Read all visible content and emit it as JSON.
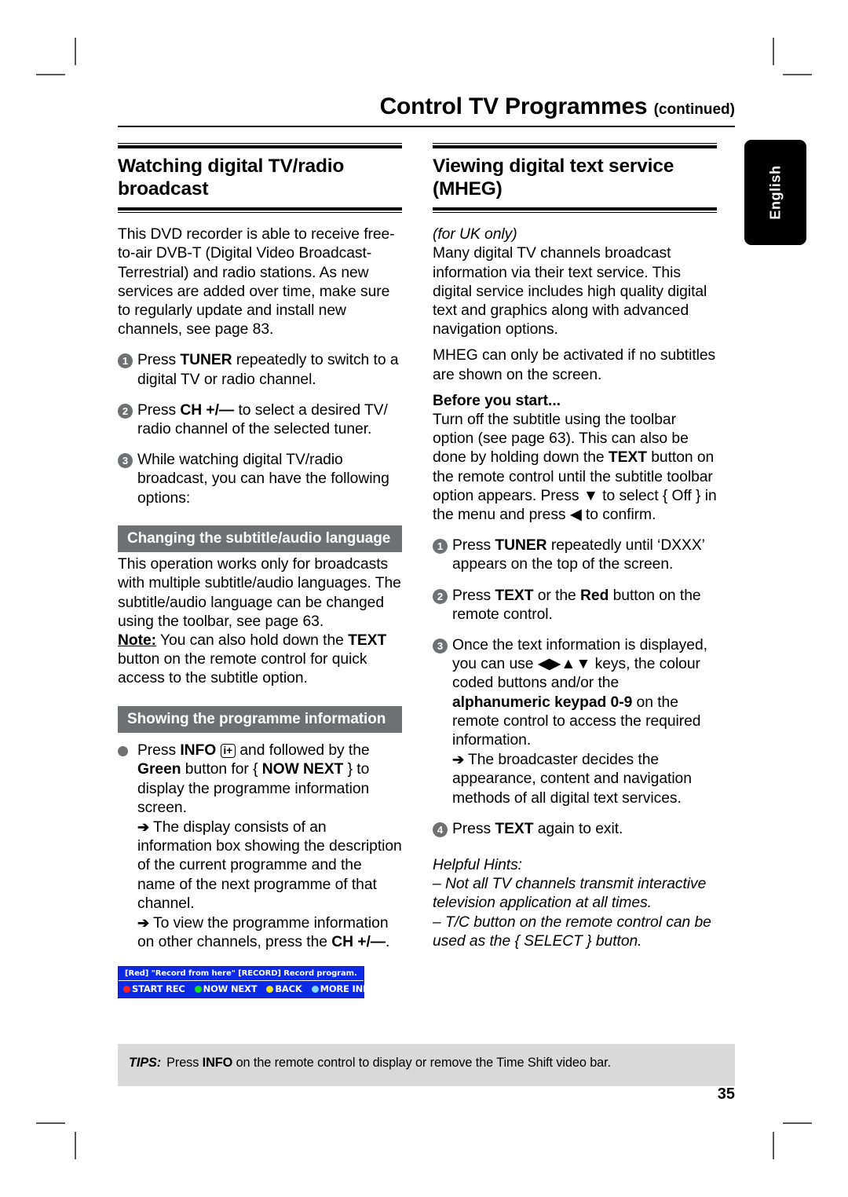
{
  "header": {
    "title": "Control TV Programmes",
    "continued": "(continued)"
  },
  "thumb_tab": {
    "label": "English"
  },
  "left_column": {
    "heading": "Watching digital TV/radio broadcast",
    "intro": "This DVD recorder is able to receive free-to-air DVB-T (Digital Video Broadcast-Terrestrial) and radio stations. As new services are added over time, make sure to regularly update and install new channels, see page 83.",
    "steps": [
      {
        "num": "1",
        "pre": "Press ",
        "bold": "TUNER",
        "post": " repeatedly to switch to a digital TV or radio channel."
      },
      {
        "num": "2",
        "pre": "Press ",
        "bold": "CH +/—",
        "post": " to select a desired TV/ radio channel of the selected tuner."
      },
      {
        "num": "3",
        "pre": "",
        "bold": "",
        "post": "While watching digital TV/radio broadcast, you can have the following options:"
      }
    ],
    "subsection_1": {
      "bar_title": "Changing the subtitle/audio language",
      "para_1": "This operation works only for broadcasts with multiple subtitle/audio languages. The subtitle/audio language can be changed using the toolbar, see page 63.",
      "note_label": "Note:",
      "note_pre": "  You can also hold down the ",
      "note_bold": "TEXT",
      "note_post": " button on the remote control for quick access to the subtitle option."
    },
    "subsection_2": {
      "bar_title": "Showing the programme information",
      "bullet_pre": "Press ",
      "bullet_bold_info": "INFO",
      "bullet_icon": "i+",
      "bullet_mid": " and followed by the ",
      "bullet_bold_green": "Green",
      "bullet_mid2": " button for { ",
      "bullet_bold_nownext": "NOW NEXT",
      "bullet_post": " } to display the programme information screen.",
      "arrow_1": "The display consists of an information box showing the description of the current programme and the name of the next programme of that channel.",
      "arrow_2_pre": "To view the programme information on other channels, press the ",
      "arrow_2_bold": "CH +/—",
      "arrow_2_post": "."
    },
    "osd": {
      "line1": "[Red] \"Record from here\"  [RECORD] Record program.",
      "buttons": [
        {
          "label": "START REC",
          "color": "#ff1f1f"
        },
        {
          "label": "NOW NEXT",
          "color": "#13e51b"
        },
        {
          "label": "BACK",
          "color": "#f2e31a"
        },
        {
          "label": "MORE INFO",
          "color": "#7fd8ff"
        }
      ],
      "bg_color": "#0b2ae8"
    }
  },
  "right_column": {
    "heading": "Viewing digital text service (MHEG)",
    "uk_note": "(for UK only)",
    "para_1": "Many digital TV channels broadcast information via their text service.  This digital service includes high quality digital text and graphics along with advanced navigation options.",
    "para_2": "MHEG can only be activated if no subtitles are shown on the screen.",
    "before_heading": "Before you start...",
    "before_pre": "Turn off the subtitle using the toolbar option (see page 63).  This can also be done by holding down the ",
    "before_bold": "TEXT",
    "before_post": " button on the remote control until the subtitle toolbar option appears.  Press ▼ to select { Off } in the menu and press ◀ to confirm.",
    "steps": [
      {
        "num": "1",
        "pre": "Press ",
        "bold": "TUNER",
        "post": " repeatedly until ‘DXXX’ appears on the top of the screen."
      },
      {
        "num": "2",
        "pre": "Press ",
        "bold": "TEXT",
        "mid": " or the ",
        "bold2": "Red",
        "post": " button on the remote control."
      },
      {
        "num": "3",
        "pre": "Once the text information is displayed, you can use ◀▶▲▼ keys, the colour coded buttons and/or the ",
        "bold": "alphanumeric keypad 0-9",
        "post": " on the remote control to access the required information.",
        "arrow": "The broadcaster decides the appearance, content and navigation methods of all digital text services."
      },
      {
        "num": "4",
        "pre": "Press ",
        "bold": "TEXT",
        "post": " again to exit."
      }
    ],
    "hints_title": "Helpful Hints:",
    "hint_1": "–  Not all TV channels transmit interactive television application at all times.",
    "hint_2": "–  T/C button on the remote control can be used as the { SELECT } button."
  },
  "footer": {
    "tips_label": "TIPS:",
    "tips_pre": "Press ",
    "tips_bold": "INFO",
    "tips_post": " on the remote control to display or remove the Time Shift video bar.",
    "page_number": "35"
  }
}
